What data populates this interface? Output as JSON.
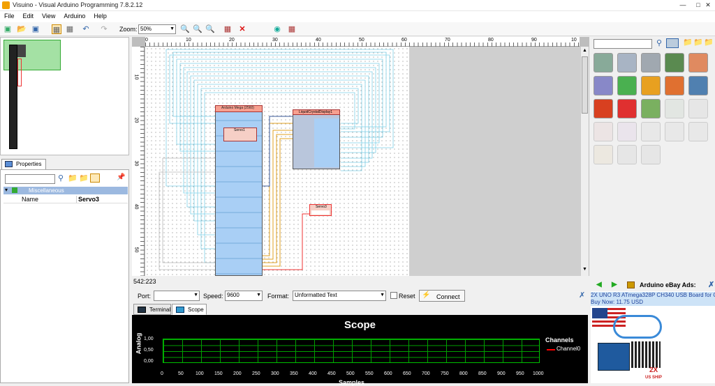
{
  "window": {
    "title": "Visuino - Visual Arduino Programming 7.8.2.12"
  },
  "menu": [
    "File",
    "Edit",
    "View",
    "Arduino",
    "Help"
  ],
  "toolbar": {
    "zoom_label": "Zoom:",
    "zoom_value": "50%"
  },
  "ruler": {
    "top": [
      "0",
      "10",
      "20",
      "30",
      "40",
      "50",
      "60",
      "70",
      "80",
      "90",
      "10"
    ],
    "left": [
      "10",
      "20",
      "30",
      "40",
      "50"
    ]
  },
  "properties": {
    "tab_label": "Properties",
    "group": "Miscellaneous",
    "name_key": "Name",
    "name_value": "Servo3"
  },
  "diagram": {
    "arduino_title": "Arduino Mega (2560)",
    "servo_title": "Servo3",
    "servo1_title": "Servo1",
    "lcd_title": "LiquidCrystalDisplay1"
  },
  "status": {
    "coords": "542:223"
  },
  "serial": {
    "port_label": "Port:",
    "port_value": "",
    "speed_label": "Speed:",
    "speed_value": "9600",
    "format_label": "Format:",
    "format_value": "Unformatted Text",
    "reset_label": "Reset",
    "connect_label": "Connect"
  },
  "bottom_tabs": [
    "Terminal",
    "Scope"
  ],
  "scope": {
    "title": "Scope",
    "y_axis": "Analog",
    "y_ticks": [
      "1,00",
      "0,50",
      "0,00"
    ],
    "x_ticks": [
      "0",
      "50",
      "100",
      "150",
      "200",
      "250",
      "300",
      "350",
      "400",
      "450",
      "500",
      "550",
      "600",
      "650",
      "700",
      "750",
      "800",
      "850",
      "900",
      "950",
      "1000"
    ],
    "x_axis": "Samples",
    "channels_title": "Channels",
    "channel0": "Channel0",
    "channel0_color": "#ff0000",
    "grid_color": "#00c000"
  },
  "ebay": {
    "header": "Arduino eBay Ads:",
    "ad_line1": "2X UNO R3 ATmega328P CH340 USB Board for C",
    "ad_line2": "Buy Now: 11.75 USD",
    "img_label": "2X",
    "img_sub": "US SHIP"
  }
}
